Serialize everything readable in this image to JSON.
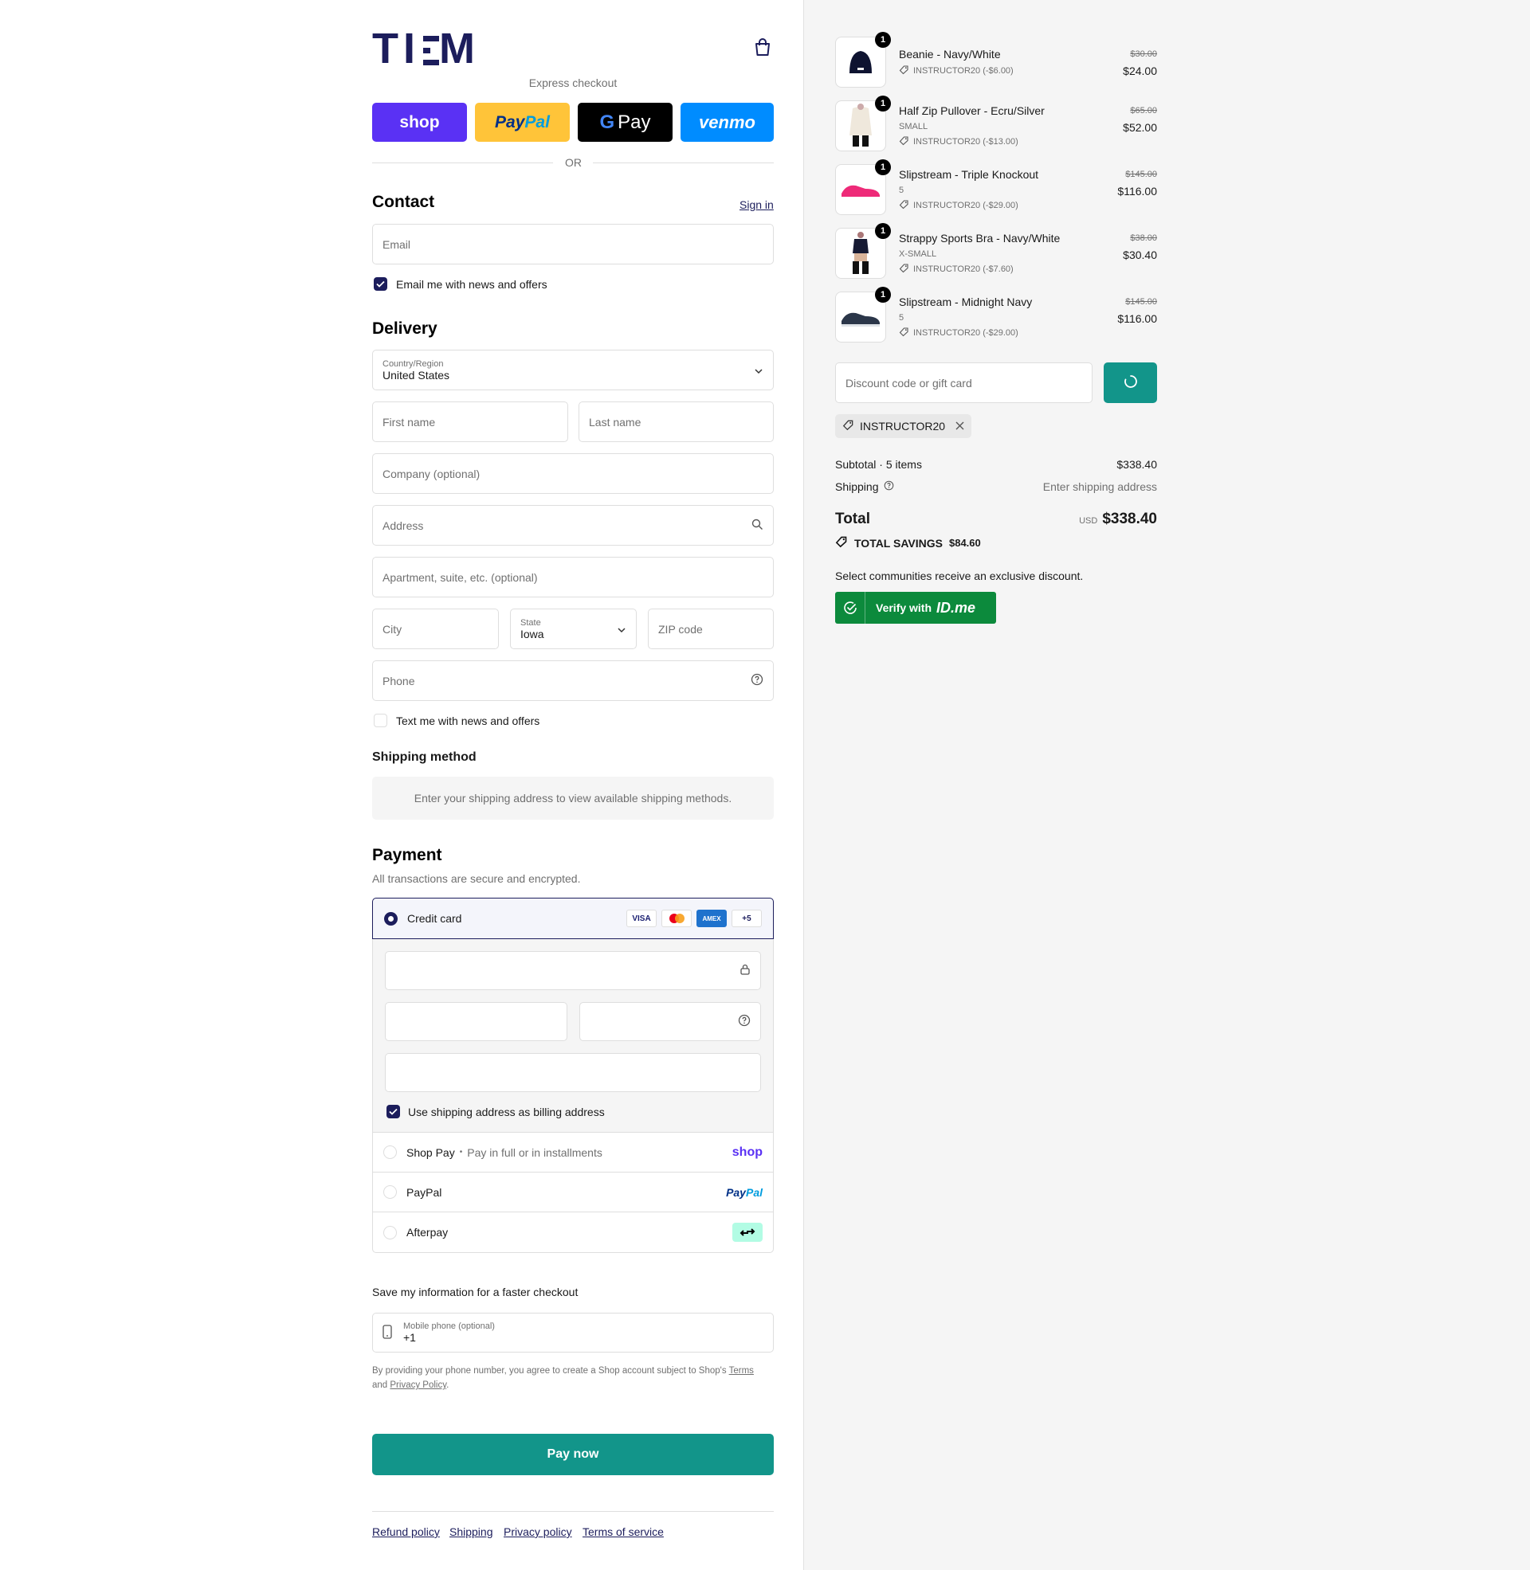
{
  "brand": {
    "logo_text": "TI∶M"
  },
  "express": {
    "label": "Express checkout",
    "buttons": [
      "shop",
      "PayPal",
      "G Pay",
      "venmo"
    ],
    "or_text": "OR"
  },
  "contact": {
    "heading": "Contact",
    "sign_in": "Sign in",
    "email_placeholder": "Email",
    "news_checkbox": "Email me with news and offers"
  },
  "delivery": {
    "heading": "Delivery",
    "country_label": "Country/Region",
    "country_value": "United States",
    "first_name": "First name",
    "last_name": "Last name",
    "company": "Company (optional)",
    "address": "Address",
    "apartment": "Apartment, suite, etc. (optional)",
    "city": "City",
    "state_label": "State",
    "state_value": "Iowa",
    "zip": "ZIP code",
    "phone": "Phone",
    "text_checkbox": "Text me with news and offers"
  },
  "shipping_method": {
    "heading": "Shipping method",
    "message": "Enter your shipping address to view available shipping methods."
  },
  "payment": {
    "heading": "Payment",
    "subtitle": "All transactions are secure and encrypted.",
    "credit_card": "Credit card",
    "card_logos": [
      "VISA",
      "MC",
      "AMEX",
      "+5"
    ],
    "billing_checkbox": "Use shipping address as billing address",
    "shop_pay": "Shop Pay",
    "shop_pay_sep": "•",
    "shop_pay_desc": "Pay in full or in installments",
    "shop_pay_logo": "shop",
    "paypal": "PayPal",
    "paypal_logo": "PayPal",
    "afterpay": "Afterpay"
  },
  "save_info": {
    "heading": "Save my information for a faster checkout",
    "mobile_label": "Mobile phone (optional)",
    "mobile_value": "+1",
    "legal_1": "By providing your phone number, you agree to create a Shop account subject to Shop's",
    "terms": "Terms",
    "and": "and",
    "privacy": "Privacy Policy",
    "period": "."
  },
  "pay_now": "Pay now",
  "footer_links": [
    "Refund policy",
    "Shipping",
    "Privacy policy",
    "Terms of service"
  ],
  "order": {
    "items": [
      {
        "name": "Beanie - Navy/White",
        "variant": "",
        "discount": "INSTRUCTOR20 (-$6.00)",
        "original": "$30.00",
        "price": "$24.00",
        "qty": "1"
      },
      {
        "name": "Half Zip Pullover - Ecru/Silver",
        "variant": "SMALL",
        "discount": "INSTRUCTOR20 (-$13.00)",
        "original": "$65.00",
        "price": "$52.00",
        "qty": "1"
      },
      {
        "name": "Slipstream - Triple Knockout",
        "variant": "5",
        "discount": "INSTRUCTOR20 (-$29.00)",
        "original": "$145.00",
        "price": "$116.00",
        "qty": "1"
      },
      {
        "name": "Strappy Sports Bra - Navy/White",
        "variant": "X-SMALL",
        "discount": "INSTRUCTOR20 (-$7.60)",
        "original": "$38.00",
        "price": "$30.40",
        "qty": "1"
      },
      {
        "name": "Slipstream - Midnight Navy",
        "variant": "5",
        "discount": "INSTRUCTOR20 (-$29.00)",
        "original": "$145.00",
        "price": "$116.00",
        "qty": "1"
      }
    ],
    "discount_placeholder": "Discount code or gift card",
    "applied_code": "INSTRUCTOR20",
    "subtotal_label": "Subtotal · 5 items",
    "subtotal_value": "$338.40",
    "shipping_label": "Shipping",
    "shipping_value": "Enter shipping address",
    "total_label": "Total",
    "currency": "USD",
    "total_value": "$338.40",
    "savings_label": "TOTAL SAVINGS",
    "savings_value": "$84.60",
    "communities": "Select communities receive an exclusive discount.",
    "verify": "Verify with",
    "idme": "ID.me"
  },
  "colors": {
    "navy": "#1c1d5c",
    "teal": "#12958a",
    "idme_green": "#0c8a3c"
  }
}
